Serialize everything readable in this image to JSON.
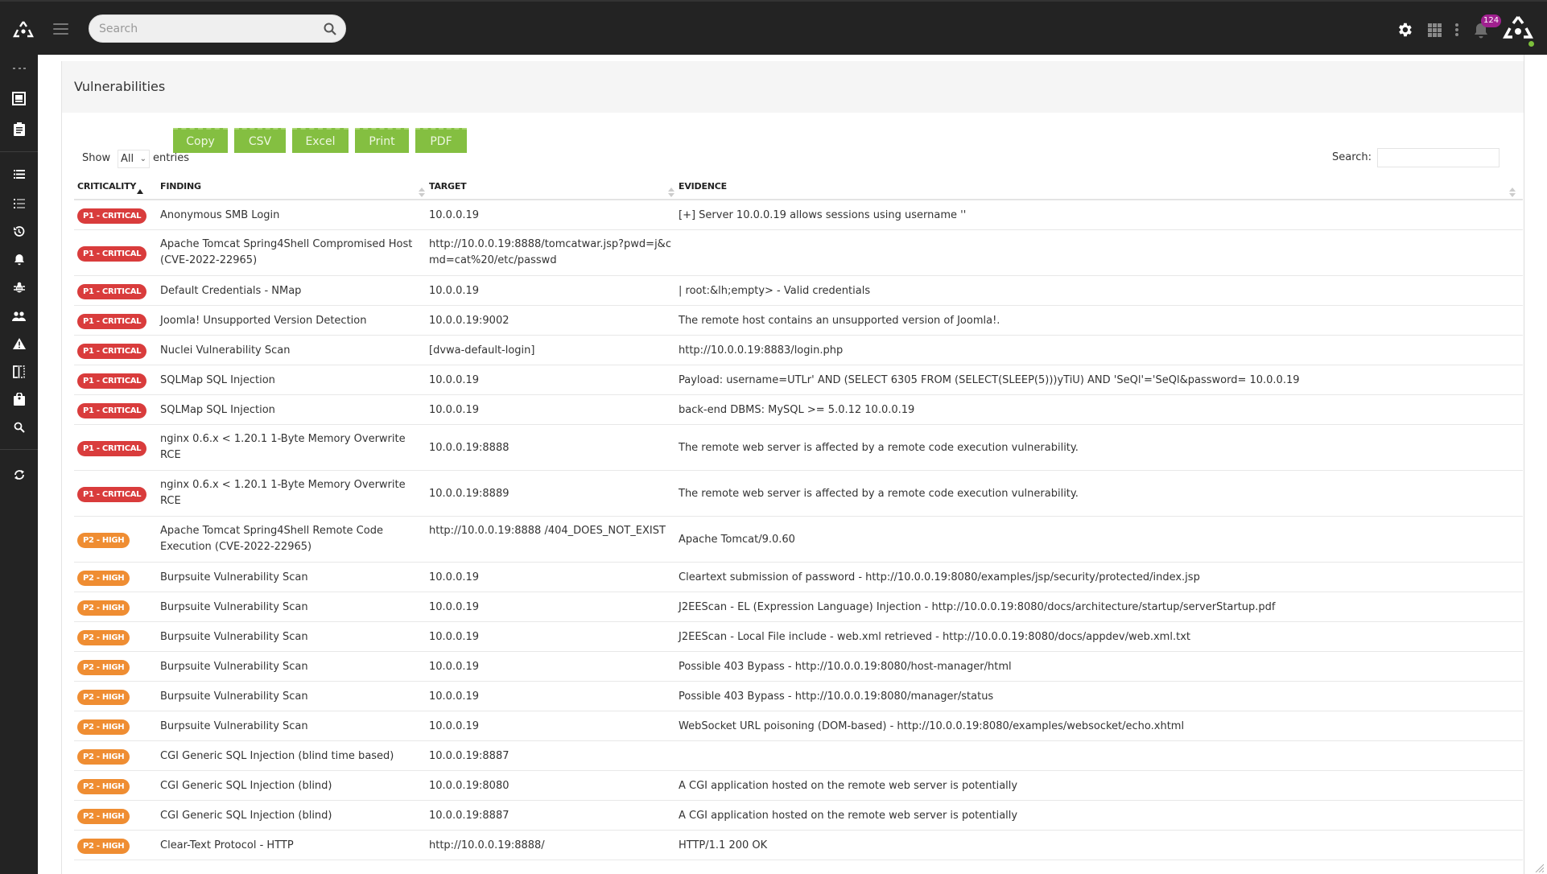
{
  "topbar": {
    "search_placeholder": "Search",
    "notification_count": "124",
    "icons": [
      "logo-icon",
      "hamburger-icon",
      "search-icon",
      "gear-icon",
      "apps-grid-icon",
      "kebab-menu-icon",
      "bell-icon",
      "brand-logo-icon"
    ]
  },
  "sidebar": {
    "items": [
      {
        "name": "more",
        "icon": "ellipsis-icon"
      },
      {
        "name": "dashboard",
        "icon": "frame-icon"
      },
      {
        "name": "reports",
        "icon": "clipboard-icon"
      },
      {
        "name": "list",
        "icon": "list-icon"
      },
      {
        "name": "checklist",
        "icon": "list-numbered-icon"
      },
      {
        "name": "history",
        "icon": "history-icon"
      },
      {
        "name": "notifications",
        "icon": "bell-icon"
      },
      {
        "name": "vulnerabilities",
        "icon": "bug-icon"
      },
      {
        "name": "users",
        "icon": "users-icon"
      },
      {
        "name": "alerts",
        "icon": "warning-icon"
      },
      {
        "name": "compare",
        "icon": "compare-icon"
      },
      {
        "name": "jobs",
        "icon": "briefcase-icon"
      },
      {
        "name": "search",
        "icon": "search-icon"
      },
      {
        "name": "refresh",
        "icon": "refresh-icon"
      }
    ]
  },
  "page": {
    "title": "Vulnerabilities",
    "show_label": "Show",
    "show_value": "All",
    "entries_label": "entries",
    "buttons": [
      "Copy",
      "CSV",
      "Excel",
      "Print",
      "PDF"
    ],
    "search_label": "Search:",
    "search_value": ""
  },
  "colors": {
    "critical": "#d93c3c",
    "high": "#ef8d32",
    "button_green": "#84bf41",
    "topbar": "#232323",
    "notification_badge": "#a0208f",
    "status_online": "#7cbf3b"
  },
  "table": {
    "columns": [
      "CRITICALITY",
      "FINDING",
      "TARGET",
      "EVIDENCE"
    ],
    "sorted_column": "CRITICALITY",
    "sort_direction": "ascending",
    "rows": [
      {
        "criticality": "P1 - CRITICAL",
        "level": "crit",
        "finding": "Anonymous SMB Login",
        "target": "10.0.0.19",
        "evidence": "[+] Server 10.0.0.19 allows sessions using username ''"
      },
      {
        "criticality": "P1 - CRITICAL",
        "level": "crit",
        "finding": "Apache Tomcat Spring4Shell Compromised Host (CVE-2022-22965)",
        "target": "http://10.0.0.19:8888/tomcatwar.jsp?pwd=j&cmd=cat%20/etc/passwd",
        "evidence": ""
      },
      {
        "criticality": "P1 - CRITICAL",
        "level": "crit",
        "finding": "Default Credentials - NMap",
        "target": "10.0.0.19",
        "evidence": "| root:&lh;empty> - Valid credentials"
      },
      {
        "criticality": "P1 - CRITICAL",
        "level": "crit",
        "finding": "Joomla! Unsupported Version Detection",
        "target": "10.0.0.19:9002",
        "evidence": "The remote host contains an unsupported version of Joomla!."
      },
      {
        "criticality": "P1 - CRITICAL",
        "level": "crit",
        "finding": "Nuclei Vulnerability Scan",
        "target": "[dvwa-default-login]",
        "evidence": "http://10.0.0.19:8883/login.php"
      },
      {
        "criticality": "P1 - CRITICAL",
        "level": "crit",
        "finding": "SQLMap SQL Injection",
        "target": "10.0.0.19",
        "evidence": "Payload: username=UTLr' AND (SELECT 6305 FROM (SELECT(SLEEP(5)))yTiU) AND 'SeQl'='SeQl&password= 10.0.0.19"
      },
      {
        "criticality": "P1 - CRITICAL",
        "level": "crit",
        "finding": "SQLMap SQL Injection",
        "target": "10.0.0.19",
        "evidence": "back-end DBMS: MySQL >= 5.0.12 10.0.0.19"
      },
      {
        "criticality": "P1 - CRITICAL",
        "level": "crit",
        "finding": "nginx 0.6.x < 1.20.1 1-Byte Memory Overwrite RCE",
        "target": "10.0.0.19:8888",
        "evidence": "The remote web server is affected by a remote code execution vulnerability."
      },
      {
        "criticality": "P1 - CRITICAL",
        "level": "crit",
        "finding": "nginx 0.6.x < 1.20.1 1-Byte Memory Overwrite RCE",
        "target": "10.0.0.19:8889",
        "evidence": "The remote web server is affected by a remote code execution vulnerability."
      },
      {
        "criticality": "P2 - HIGH",
        "level": "high",
        "finding": "Apache Tomcat Spring4Shell Remote Code Execution (CVE-2022-22965)",
        "target": "http://10.0.0.19:8888 /404_DOES_NOT_EXIST",
        "evidence": "Apache Tomcat/9.0.60"
      },
      {
        "criticality": "P2 - HIGH",
        "level": "high",
        "finding": "Burpsuite Vulnerability Scan",
        "target": "10.0.0.19",
        "evidence": "Cleartext submission of password - http://10.0.0.19:8080/examples/jsp/security/protected/index.jsp"
      },
      {
        "criticality": "P2 - HIGH",
        "level": "high",
        "finding": "Burpsuite Vulnerability Scan",
        "target": "10.0.0.19",
        "evidence": "J2EEScan - EL (Expression Language) Injection - http://10.0.0.19:8080/docs/architecture/startup/serverStartup.pdf"
      },
      {
        "criticality": "P2 - HIGH",
        "level": "high",
        "finding": "Burpsuite Vulnerability Scan",
        "target": "10.0.0.19",
        "evidence": "J2EEScan - Local File include - web.xml retrieved - http://10.0.0.19:8080/docs/appdev/web.xml.txt"
      },
      {
        "criticality": "P2 - HIGH",
        "level": "high",
        "finding": "Burpsuite Vulnerability Scan",
        "target": "10.0.0.19",
        "evidence": "Possible 403 Bypass - http://10.0.0.19:8080/host-manager/html"
      },
      {
        "criticality": "P2 - HIGH",
        "level": "high",
        "finding": "Burpsuite Vulnerability Scan",
        "target": "10.0.0.19",
        "evidence": "Possible 403 Bypass - http://10.0.0.19:8080/manager/status"
      },
      {
        "criticality": "P2 - HIGH",
        "level": "high",
        "finding": "Burpsuite Vulnerability Scan",
        "target": "10.0.0.19",
        "evidence": "WebSocket URL poisoning (DOM-based) - http://10.0.0.19:8080/examples/websocket/echo.xhtml"
      },
      {
        "criticality": "P2 - HIGH",
        "level": "high",
        "finding": "CGI Generic SQL Injection (blind time based)",
        "target": "10.0.0.19:8887",
        "evidence": ""
      },
      {
        "criticality": "P2 - HIGH",
        "level": "high",
        "finding": "CGI Generic SQL Injection (blind)",
        "target": "10.0.0.19:8080",
        "evidence": "A CGI application hosted on the remote web server is potentially"
      },
      {
        "criticality": "P2 - HIGH",
        "level": "high",
        "finding": "CGI Generic SQL Injection (blind)",
        "target": "10.0.0.19:8887",
        "evidence": "A CGI application hosted on the remote web server is potentially"
      },
      {
        "criticality": "P2 - HIGH",
        "level": "high",
        "finding": "Clear-Text Protocol - HTTP",
        "target": "http://10.0.0.19:8888/",
        "evidence": "HTTP/1.1 200 OK"
      }
    ]
  }
}
